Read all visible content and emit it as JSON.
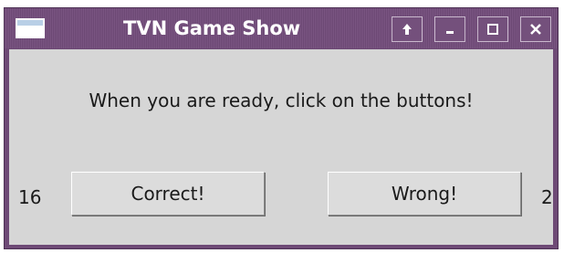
{
  "window": {
    "title": "TVN Game Show"
  },
  "titlebar_buttons": [
    {
      "name": "shade-icon",
      "glyph": "up-arrow"
    },
    {
      "name": "minimize-icon",
      "glyph": "underscore"
    },
    {
      "name": "maximize-icon",
      "glyph": "square"
    },
    {
      "name": "close-icon",
      "glyph": "x"
    }
  ],
  "content": {
    "message": "When you are ready, click on the buttons!",
    "correct_count": "16",
    "correct_label": "Correct!",
    "wrong_label": "Wrong!",
    "wrong_count": "2"
  },
  "colors": {
    "titlebar": "#6e4a76",
    "client_bg": "#d6d6d6",
    "title_text": "#ffffff"
  }
}
